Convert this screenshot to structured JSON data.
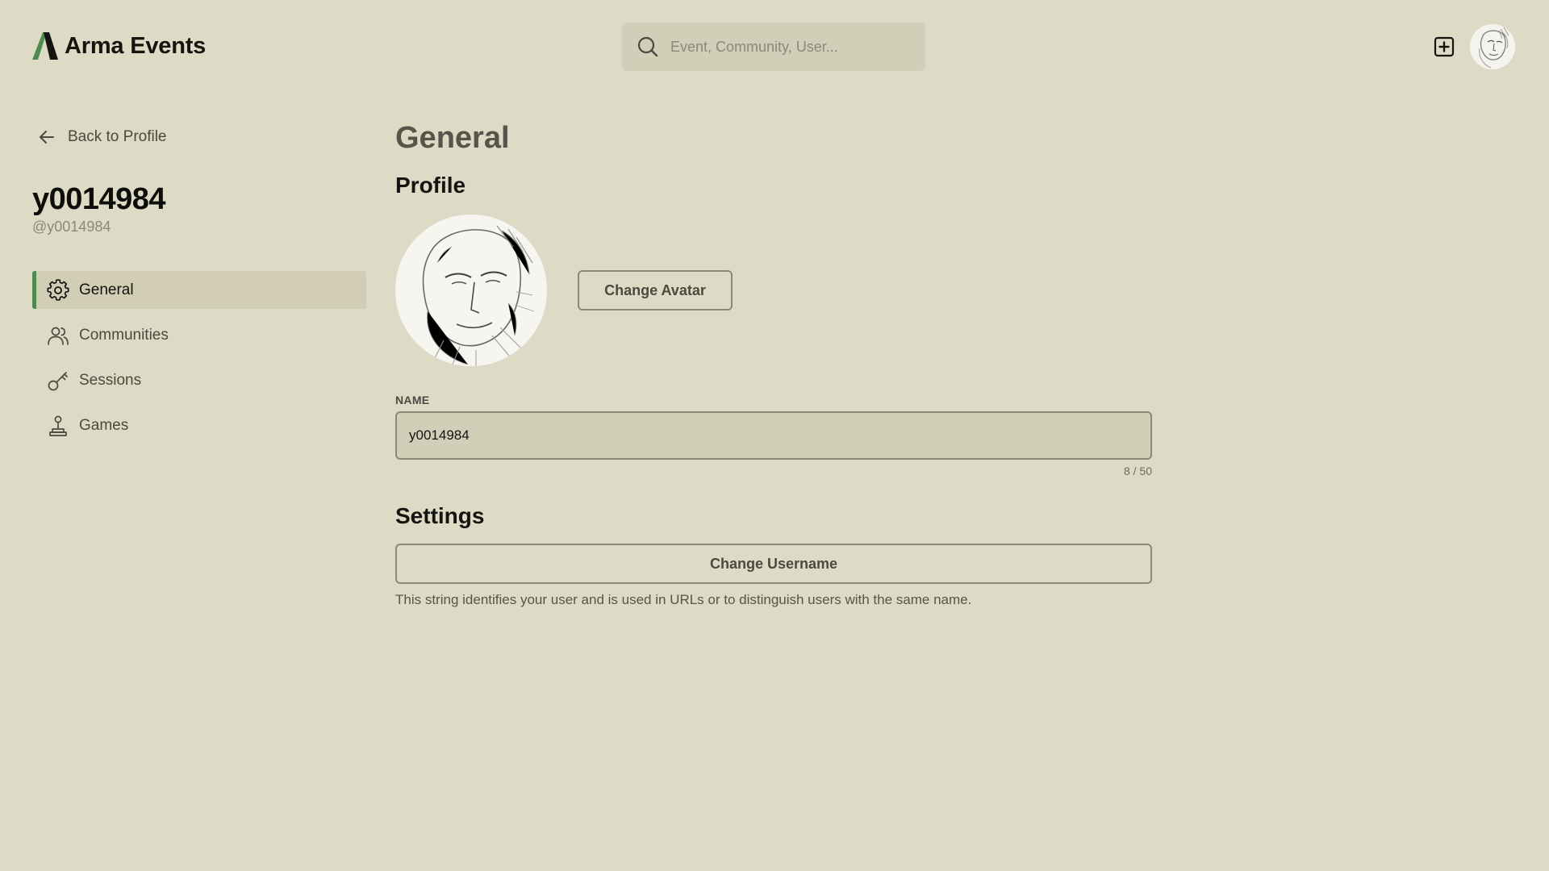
{
  "app": {
    "brand_name": "Arma Events",
    "accent_color": "#4f8a4e",
    "background_color": "#dddbc5"
  },
  "header": {
    "search_placeholder": "Event, Community, User...",
    "create_icon": "plus-square-icon",
    "avatar_icon": "avatar-sketch"
  },
  "sidebar": {
    "back_label": "Back to Profile",
    "display_name": "y0014984",
    "handle": "@y0014984",
    "items": [
      {
        "label": "General",
        "icon": "gear-icon",
        "active": true
      },
      {
        "label": "Communities",
        "icon": "users-icon",
        "active": false
      },
      {
        "label": "Sessions",
        "icon": "key-icon",
        "active": false
      },
      {
        "label": "Games",
        "icon": "joystick-icon",
        "active": false
      }
    ]
  },
  "main": {
    "title": "General",
    "profile_section": {
      "title": "Profile",
      "change_avatar_label": "Change Avatar",
      "name_label": "NAME",
      "name_value": "y0014984",
      "name_count": "8 / 50"
    },
    "settings_section": {
      "title": "Settings",
      "change_username_label": "Change Username",
      "helper_text": "This string identifies your user and is used in URLs or to distinguish users with the same name."
    }
  }
}
